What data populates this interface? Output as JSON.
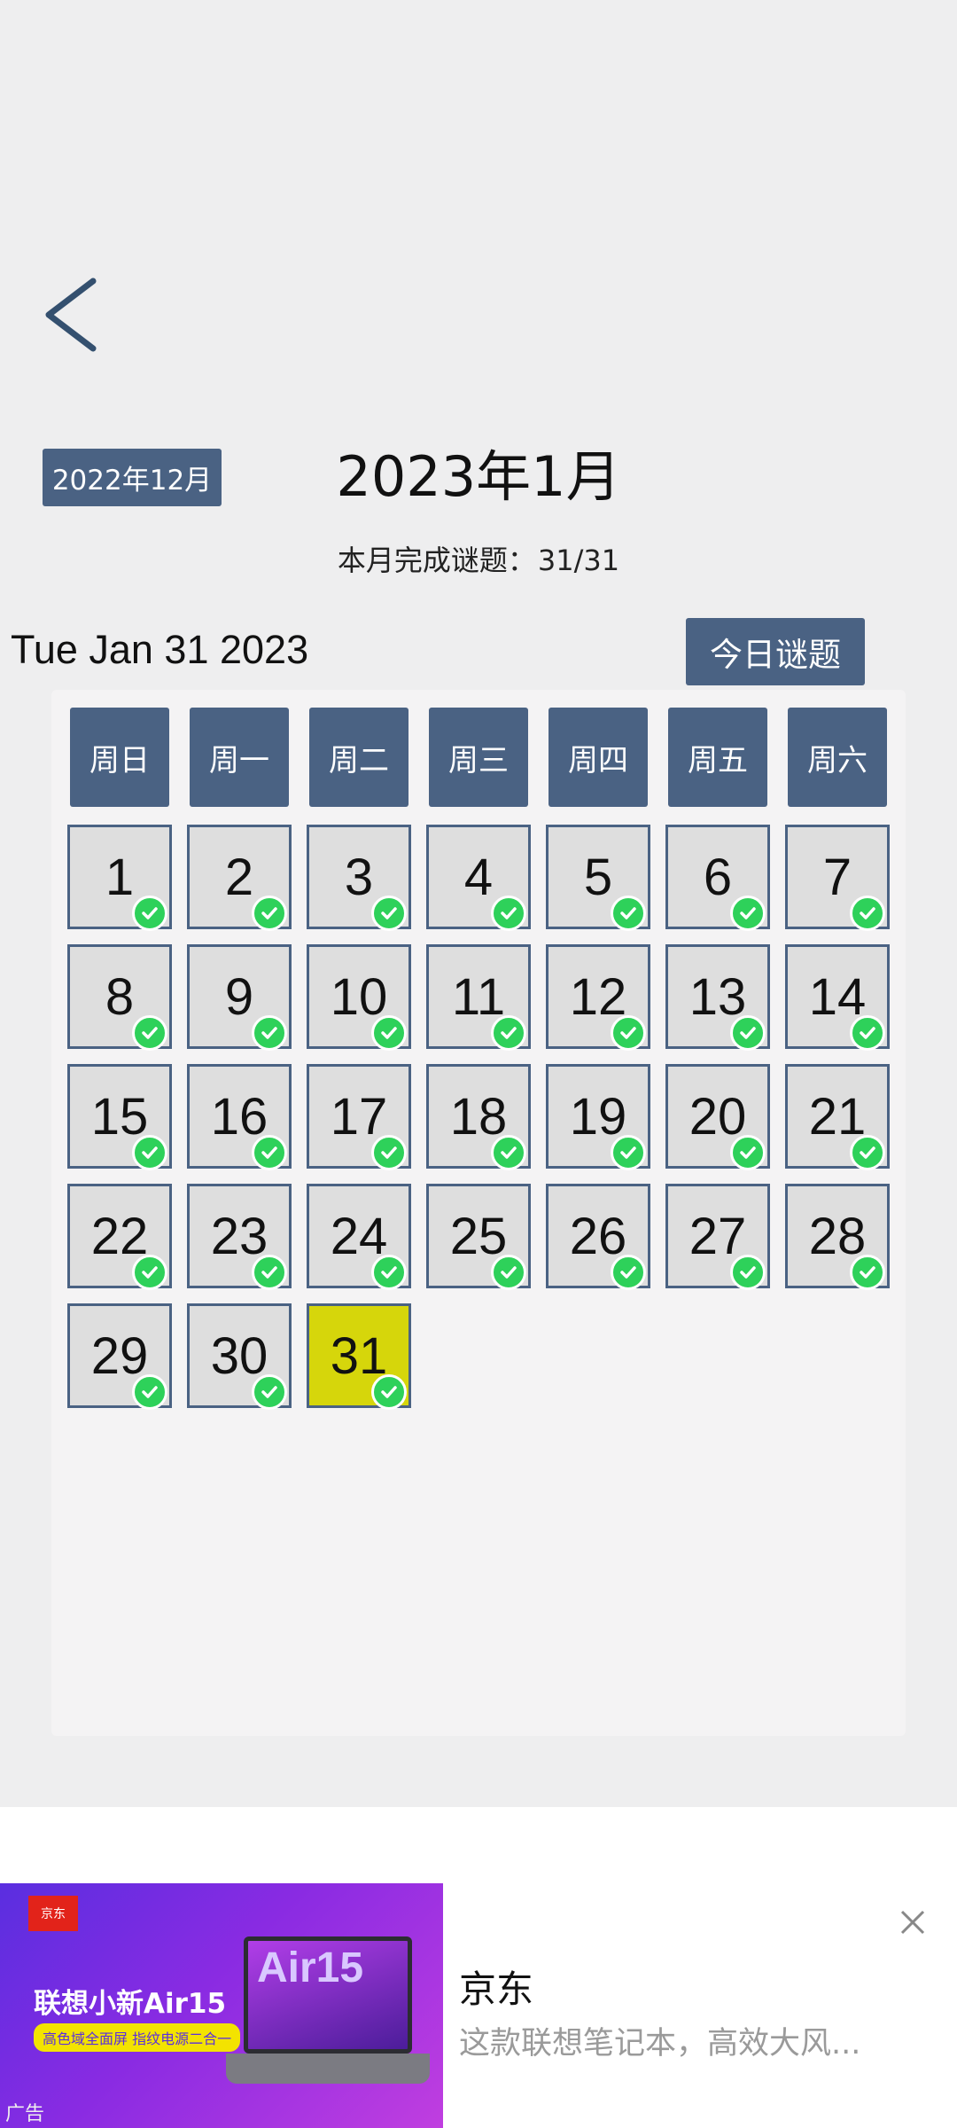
{
  "nav": {
    "back_icon": "chevron-left-icon"
  },
  "header": {
    "prev_month_label": "2022年12月",
    "month_title": "2023年1月",
    "progress_label": "本月完成谜题：",
    "progress_value": "31/31",
    "current_date": "Tue Jan 31 2023",
    "today_button": "今日谜题"
  },
  "calendar": {
    "weekdays": [
      "周日",
      "周一",
      "周二",
      "周三",
      "周四",
      "周五",
      "周六"
    ],
    "days": [
      "1",
      "2",
      "3",
      "4",
      "5",
      "6",
      "7",
      "8",
      "9",
      "10",
      "11",
      "12",
      "13",
      "14",
      "15",
      "16",
      "17",
      "18",
      "19",
      "20",
      "21",
      "22",
      "23",
      "24",
      "25",
      "26",
      "27",
      "28",
      "29",
      "30",
      "31"
    ],
    "today": "31",
    "completed_icon": "check-circle-icon"
  },
  "colors": {
    "accent": "#4a6283",
    "today_highlight": "#d6d60b",
    "check": "#2ed15a"
  },
  "ad": {
    "logo_text": "京东",
    "headline": "联想小新Air15",
    "tagline": "高色域全面屏 指纹电源二合一",
    "product_text": "Air15",
    "label": "广告",
    "title": "京东",
    "description": "这款联想笔记本，高效大风...",
    "close_icon": "close-icon"
  }
}
